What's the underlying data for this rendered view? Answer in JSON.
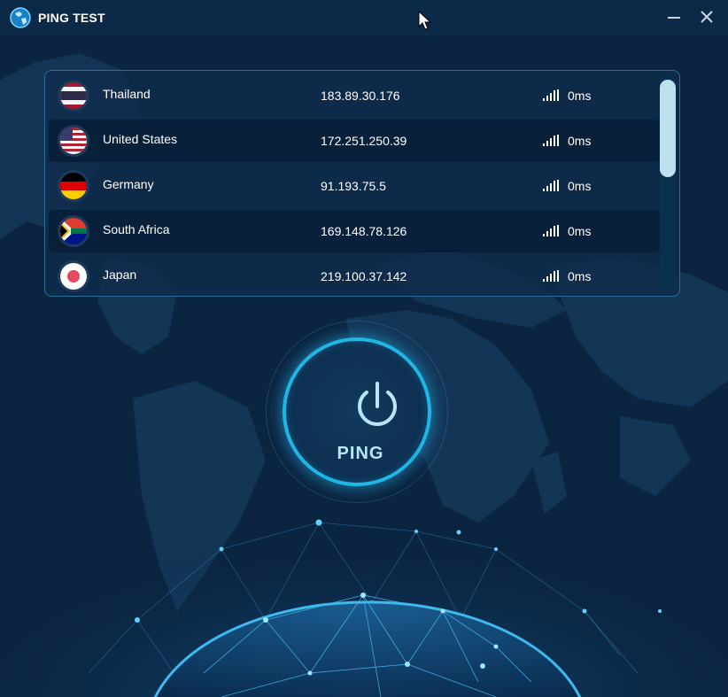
{
  "app": {
    "title": "PING TEST"
  },
  "servers": [
    {
      "country": "Thailand",
      "ip": "183.89.30.176",
      "ping": "0ms",
      "flag": "thailand-flag"
    },
    {
      "country": "United States",
      "ip": "172.251.250.39",
      "ping": "0ms",
      "flag": "us-flag"
    },
    {
      "country": "Germany",
      "ip": "91.193.75.5",
      "ping": "0ms",
      "flag": "germany-flag"
    },
    {
      "country": "South Africa",
      "ip": "169.148.78.126",
      "ping": "0ms",
      "flag": "south-africa-flag"
    },
    {
      "country": "Japan",
      "ip": "219.100.37.142",
      "ping": "0ms",
      "flag": "japan-flag"
    }
  ],
  "ping_button": {
    "label": "PING"
  },
  "colors": {
    "accent": "#1fb6e6",
    "background": "#0b2440",
    "panel_border": "#2c6e99"
  }
}
